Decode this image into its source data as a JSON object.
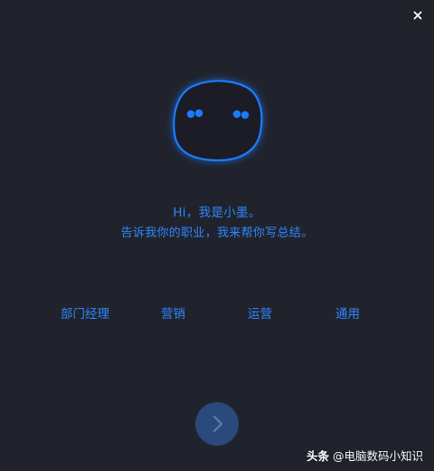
{
  "window": {
    "close_icon": "close-icon",
    "background": "#20232c"
  },
  "greeting": {
    "line1": "Hi，我是小墨。",
    "line2": "告诉我你的职业，我来帮你写总结。"
  },
  "professions": [
    {
      "label": "部门经理"
    },
    {
      "label": "营销"
    },
    {
      "label": "运营"
    },
    {
      "label": "通用"
    }
  ],
  "next_button": {
    "icon": "chevron-right-icon"
  },
  "watermark": {
    "source": "头条",
    "handle": "@电脑数码小知识"
  },
  "colors": {
    "accent": "#2f86ff",
    "mascot_glow": "#1a7cff",
    "next_button": "#2a4a7c"
  }
}
